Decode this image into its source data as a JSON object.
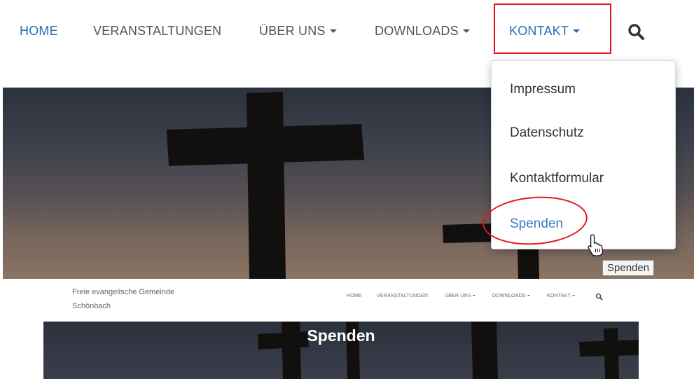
{
  "top_nav": {
    "items": [
      {
        "label": "HOME"
      },
      {
        "label": "VERANSTALTUNGEN"
      },
      {
        "label": "ÜBER UNS"
      },
      {
        "label": "DOWNLOADS"
      },
      {
        "label": "KONTAKT"
      }
    ],
    "active_color": "#2a6ebb"
  },
  "dropdown": {
    "items": [
      {
        "label": "Impressum"
      },
      {
        "label": "Datenschutz"
      },
      {
        "label": "Kontaktformular"
      },
      {
        "label": "Spenden"
      }
    ]
  },
  "tooltip": {
    "text": "Spenden"
  },
  "site": {
    "title_line1": "Freie evangelische Gemeinde",
    "title_line2": "Schönbach"
  },
  "small_nav": {
    "items": [
      {
        "label": "HOME"
      },
      {
        "label": "VERANSTALTUNGEN"
      },
      {
        "label": "ÜBER UNS"
      },
      {
        "label": "DOWNLOADS"
      },
      {
        "label": "KONTAKT"
      }
    ]
  },
  "page": {
    "title": "Spenden"
  },
  "colors": {
    "annotation_red": "#e2141b",
    "link_blue": "#3d7cc9"
  }
}
